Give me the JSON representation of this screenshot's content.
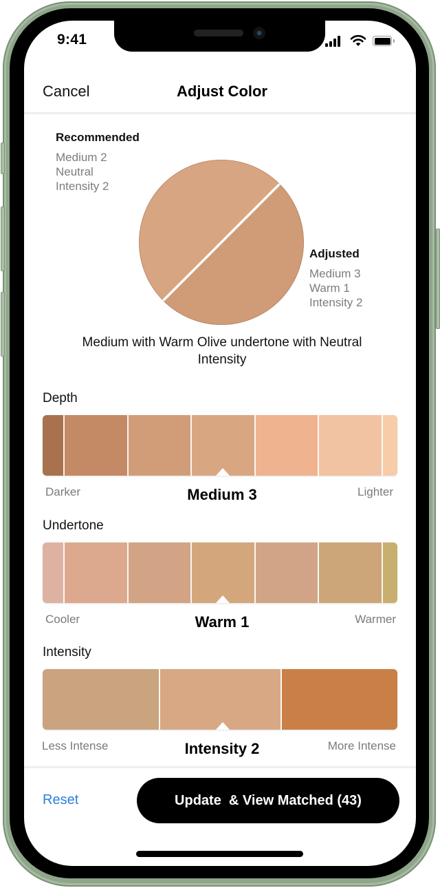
{
  "status_bar": {
    "time": "9:41",
    "icons": [
      "cellular-signal-icon",
      "wifi-icon",
      "battery-icon"
    ]
  },
  "nav": {
    "cancel_label": "Cancel",
    "title": "Adjust Color"
  },
  "recommended": {
    "title": "Recommended",
    "lines": [
      "Medium 2",
      "Neutral",
      "Intensity 2"
    ],
    "color": "#d7a582"
  },
  "adjusted": {
    "title": "Adjusted",
    "lines": [
      "Medium 3",
      "Warm 1",
      "Intensity 2"
    ],
    "color": "#d09c78"
  },
  "summary": "Medium with Warm Olive undertone with Neutral Intensity",
  "sliders": [
    {
      "label": "Depth",
      "left_label": "Darker",
      "right_label": "Lighter",
      "value": "Medium 3",
      "selected_index": 3,
      "segments": [
        "#a8724e",
        "#c38a65",
        "#d19d79",
        "#d9a682",
        "#efb48f",
        "#f2c3a2",
        "#f7cca9"
      ]
    },
    {
      "label": "Undertone",
      "left_label": "Cooler",
      "right_label": "Warmer",
      "value": "Warm 1",
      "selected_index": 3,
      "segments": [
        "#ddb2a3",
        "#dca98f",
        "#d2a385",
        "#d4a67b",
        "#d2a487",
        "#cca679",
        "#c8af6f"
      ]
    },
    {
      "label": "Intensity",
      "left_label": "Less Intense",
      "right_label": "More Intense",
      "value": "Intensity 2",
      "selected_index": 1,
      "segments": [
        "#caa47f",
        "#d8a884",
        "#c97f46"
      ]
    }
  ],
  "footer": {
    "reset_label": "Reset",
    "cta_label": "Update  & View Matched (43)"
  },
  "colors": {
    "accent": "#2a7fe0",
    "cta_bg": "#000000",
    "frame": "#8fa68b"
  }
}
